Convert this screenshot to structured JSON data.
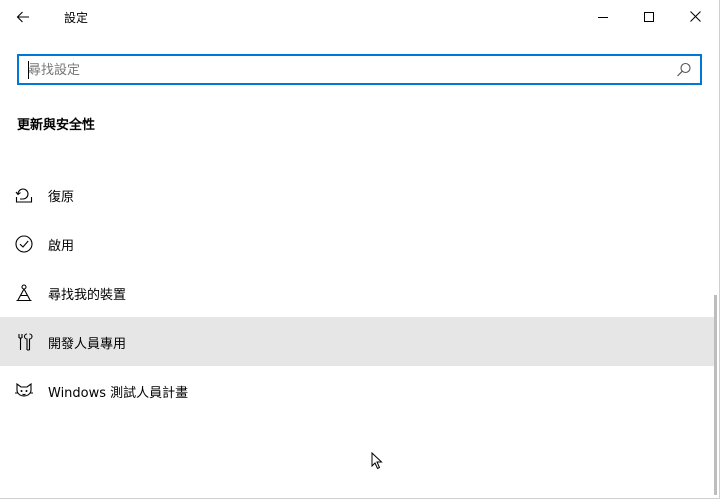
{
  "titlebar": {
    "title": "設定",
    "back_icon": "arrow-left-icon",
    "minimize_icon": "minimize-icon",
    "maximize_icon": "maximize-icon",
    "close_icon": "close-icon"
  },
  "search": {
    "placeholder": "尋找設定",
    "value": "",
    "icon": "search-icon"
  },
  "section": {
    "title": "更新與安全性"
  },
  "nav": {
    "items": [
      {
        "label": "復原",
        "icon": "recovery-icon",
        "selected": false
      },
      {
        "label": "啟用",
        "icon": "check-circle-icon",
        "selected": false
      },
      {
        "label": "尋找我的裝置",
        "icon": "find-device-icon",
        "selected": false
      },
      {
        "label": "開發人員專用",
        "icon": "developer-tools-icon",
        "selected": true
      },
      {
        "label": "Windows 測試人員計畫",
        "icon": "insider-cat-icon",
        "selected": false
      }
    ]
  },
  "colors": {
    "accent": "#0078d7",
    "selected_bg": "#e6e6e6",
    "placeholder": "#767676"
  }
}
